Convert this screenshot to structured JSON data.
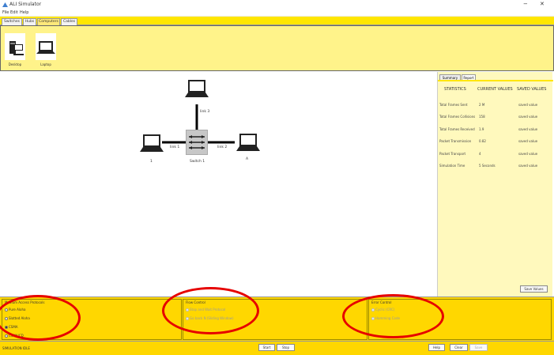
{
  "window": {
    "title": "ALI Simulator",
    "minimize_label": "−",
    "close_label": "✕"
  },
  "menu": {
    "items": [
      "File",
      "Edit",
      "Help"
    ]
  },
  "device_tabs": [
    "Switches",
    "Hubs",
    "Computers",
    "Cables"
  ],
  "palette": {
    "devices": [
      {
        "icon": "desktop-icon",
        "label": "Desktop"
      },
      {
        "icon": "laptop-icon",
        "label": "Laptop"
      }
    ]
  },
  "topology": {
    "switch_label": "Switch 1",
    "links": [
      {
        "label": "link 1"
      },
      {
        "label": "link 2"
      },
      {
        "label": "link 3"
      }
    ],
    "hosts": [
      {
        "label": ""
      },
      {
        "label": "1"
      },
      {
        "label": "A"
      }
    ]
  },
  "right_panel": {
    "tabs": [
      "Summary",
      "Report"
    ],
    "headers": [
      "STATISTICS",
      "CURRENT VALUES",
      "SAVED VALUES"
    ],
    "rows": [
      {
        "name": "Total Frames Sent",
        "current": "2 M",
        "saved": "saved value"
      },
      {
        "name": "Total Frames Collisions",
        "current": "158",
        "saved": "saved value"
      },
      {
        "name": "Total Frames Received",
        "current": "1.9",
        "saved": "saved value"
      },
      {
        "name": "Packet Transmission",
        "current": "0.82",
        "saved": "saved value"
      },
      {
        "name": "Packet Transport",
        "current": "4",
        "saved": "saved value"
      },
      {
        "name": "Simulation Time",
        "current": "5 Seconds",
        "saved": "saved value"
      }
    ],
    "save_button": "Save Values"
  },
  "options": {
    "group1": {
      "title": "Medium Access Protocols",
      "items": [
        "Pure Aloha",
        "Slotted Aloha",
        "CSMA",
        "CSMA/CD"
      ],
      "selected_index": 2
    },
    "group2": {
      "title": "Flow Control",
      "items": [
        "Stop and Wait Protocol",
        "Go back N (Sliding Window)"
      ]
    },
    "group3": {
      "title": "Error Control",
      "items": [
        "Cyclic (CRC)",
        "Hamming Code"
      ]
    }
  },
  "status": {
    "text": "SIMULATION IDLE",
    "start_button": "Start",
    "stop_button": "Stop",
    "help_button": "Help",
    "clear_button": "Clear",
    "save_button": "Save"
  },
  "colors": {
    "yellow": "#ffd700",
    "highlight_red": "#e60000"
  }
}
